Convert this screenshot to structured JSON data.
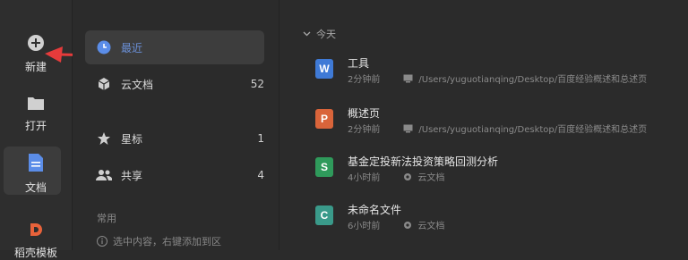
{
  "rail": {
    "new_label": "新建",
    "open_label": "打开",
    "docs_label": "文档",
    "bottom_label": "稻壳模板"
  },
  "sidebar": {
    "recent_label": "最近",
    "cloud_label": "云文档",
    "cloud_count": "52",
    "star_label": "星标",
    "star_count": "1",
    "share_label": "共享",
    "share_count": "4",
    "section_title": "常用",
    "hint": "选中内容，右键添加到区"
  },
  "main": {
    "day_header": "今天",
    "files": [
      {
        "name": "工具",
        "time": "2分钟前",
        "location": "/Users/yuguotianqing/Desktop/百度经验概述和总述页",
        "type": "W",
        "color": "#3f7ad6"
      },
      {
        "name": "概述页",
        "time": "2分钟前",
        "location": "/Users/yuguotianqing/Desktop/百度经验概述和总述页",
        "type": "P",
        "color": "#d9643a"
      },
      {
        "name": "基金定投新法投资策略回测分析",
        "time": "4小时前",
        "location": "云文档",
        "type": "S",
        "color": "#2f9a5b"
      },
      {
        "name": "未命名文件",
        "time": "6小时前",
        "location": "云文档",
        "type": "C",
        "color": "#3a9a8a"
      }
    ]
  },
  "colors": {
    "accent": "#e63b3b",
    "recent_icon": "#5b8de8"
  }
}
